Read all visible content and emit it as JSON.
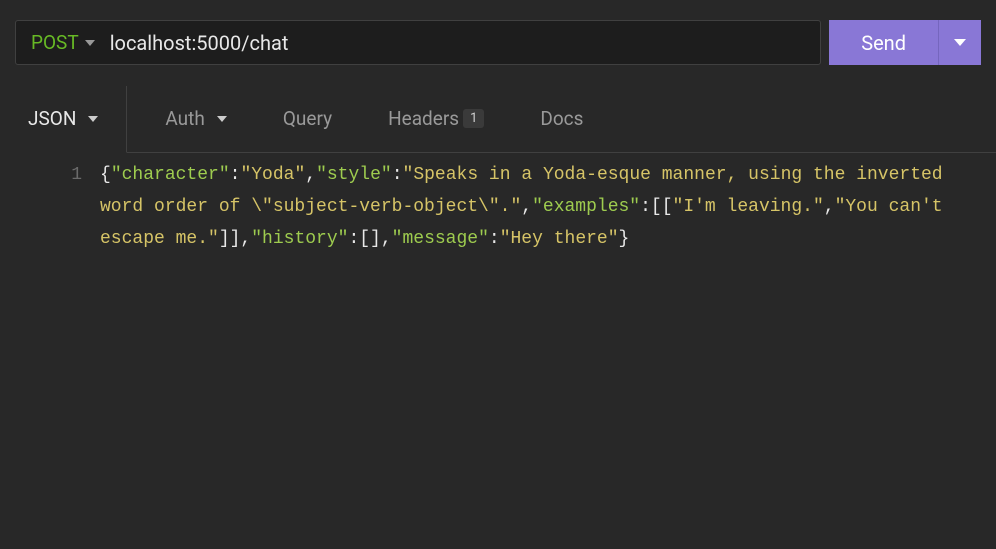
{
  "request": {
    "method": "POST",
    "url": "localhost:5000/chat",
    "send_label": "Send"
  },
  "tabs": {
    "body_type": {
      "label": "JSON"
    },
    "auth": {
      "label": "Auth"
    },
    "query": {
      "label": "Query"
    },
    "headers": {
      "label": "Headers",
      "badge": "1"
    },
    "docs": {
      "label": "Docs"
    }
  },
  "editor": {
    "line_number": "1",
    "json_tokens": {
      "k1": "\"character\"",
      "v1": "\"Yoda\"",
      "k2": "\"style\"",
      "v2": "\"Speaks in a Yoda-esque manner, using the inverted word order of \\\"subject-verb-object\\\".\"",
      "k3": "\"examples\"",
      "v3a": "\"I'm leaving.\"",
      "v3b": "\"You can't escape me.\"",
      "k4": "\"history\"",
      "k5": "\"message\"",
      "v5": "\"Hey there\""
    }
  }
}
